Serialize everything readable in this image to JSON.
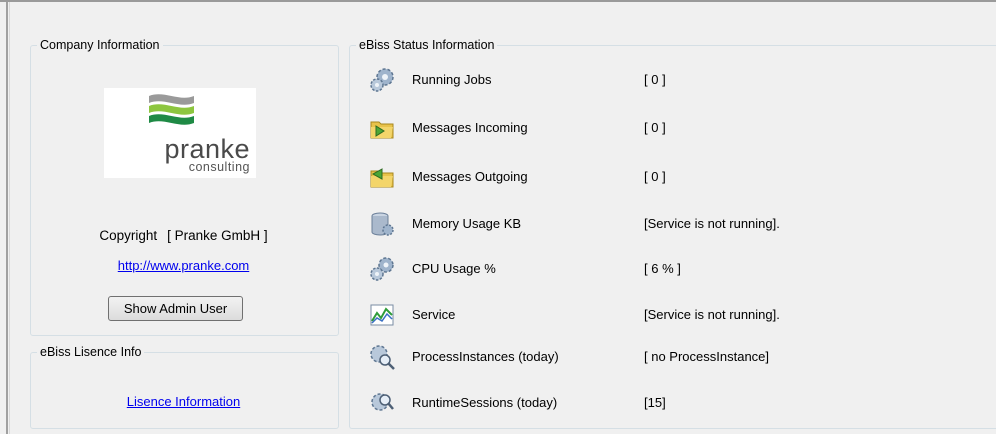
{
  "company": {
    "legend": "Company Information",
    "logo_text": "pranke",
    "logo_subtext": "consulting",
    "copyright_label": "Copyright",
    "copyright_value": "[ Pranke GmbH ]",
    "website": "http://www.pranke.com",
    "admin_button": "Show Admin User"
  },
  "licence": {
    "legend": "eBiss Lisence Info",
    "link": "Lisence Information"
  },
  "status": {
    "legend": "eBiss Status Information",
    "rows": [
      {
        "label": "Running Jobs",
        "value": "[ 0 ]",
        "icon": "gears-icon"
      },
      {
        "label": "Messages Incoming",
        "value": "[ 0 ]",
        "icon": "incoming-folder-icon"
      },
      {
        "label": "Messages Outgoing",
        "value": "[ 0 ]",
        "icon": "outgoing-folder-icon"
      },
      {
        "label": "Memory Usage KB",
        "value": "[Service is not running].",
        "icon": "database-gear-icon"
      },
      {
        "label": "CPU Usage %",
        "value": "[ 6 % ]",
        "icon": "gears-icon"
      },
      {
        "label": "Service",
        "value": "[Service is not running].",
        "icon": "chart-icon"
      },
      {
        "label": "ProcessInstances (today)",
        "value": "[ no ProcessInstance]",
        "icon": "gear-search-icon"
      },
      {
        "label": "RuntimeSessions (today)",
        "value": "[15]",
        "icon": "gear-search-icon"
      }
    ]
  }
}
